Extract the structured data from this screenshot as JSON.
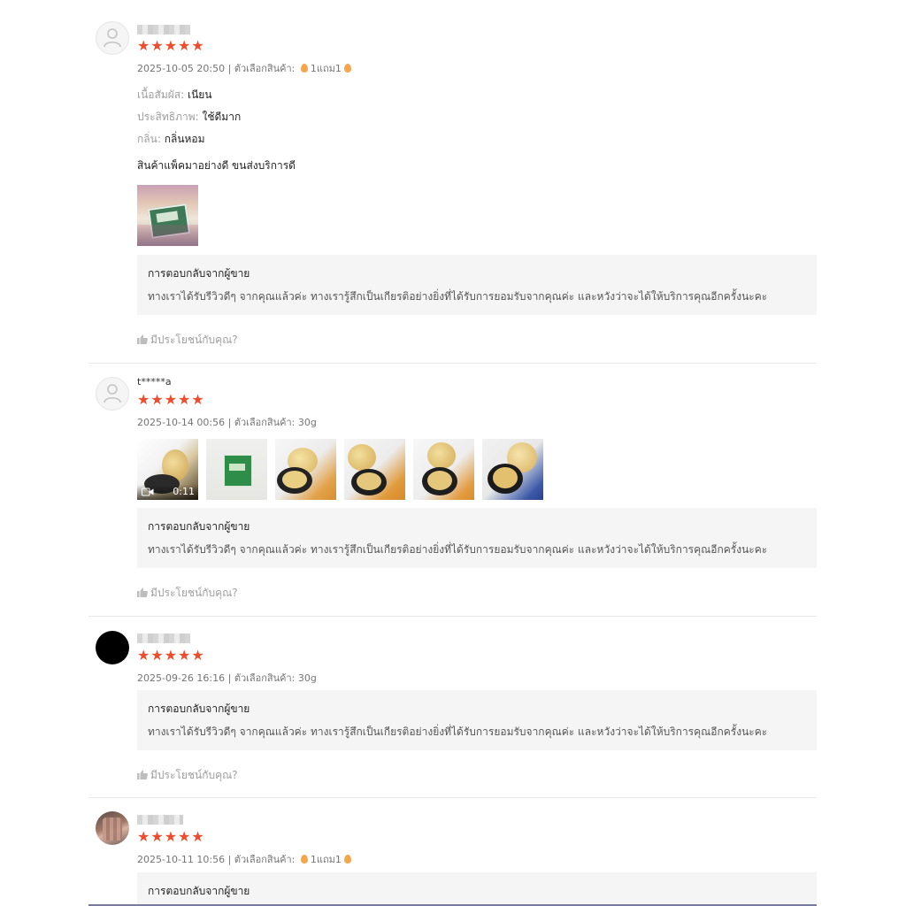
{
  "reviews": [
    {
      "username": "",
      "rating": 5,
      "date": "2025-10-05 20:50",
      "variation_label": "ตัวเลือกสินค้า:",
      "variation": "1แถม1",
      "attributes": [
        {
          "key": "เนื้อสัมผัส:",
          "value": "เนียน"
        },
        {
          "key": "ประสิทธิภาพ:",
          "value": "ใช้ดีมาก"
        },
        {
          "key": "กลิ่น:",
          "value": "กลิ่นหอม"
        }
      ],
      "comment": "สินค้าแพ็คมาอย่างดี ขนส่งบริการดี",
      "seller_reply_title": "การตอบกลับจากผู้ขาย",
      "seller_reply": "ทางเราได้รับรีวิวดีๆ จากคุณแล้วค่ะ ทางเรารู้สึกเป็นเกียรติอย่างยิ่งที่ได้รับการยอมรับจากคุณค่ะ และหวังว่าจะได้ให้บริการคุณอีกครั้งนะคะ",
      "helpful": "มีประโยชน์กับคุณ?"
    },
    {
      "username": "t*****a",
      "rating": 5,
      "date": "2025-10-14 00:56",
      "variation_label": "ตัวเลือกสินค้า:",
      "variation": "30g",
      "video_duration": "0:11",
      "seller_reply_title": "การตอบกลับจากผู้ขาย",
      "seller_reply": "ทางเราได้รับรีวิวดีๆ จากคุณแล้วค่ะ ทางเรารู้สึกเป็นเกียรติอย่างยิ่งที่ได้รับการยอมรับจากคุณค่ะ และหวังว่าจะได้ให้บริการคุณอีกครั้งนะคะ",
      "helpful": "มีประโยชน์กับคุณ?"
    },
    {
      "username": "",
      "rating": 5,
      "date": "2025-09-26 16:16",
      "variation_label": "ตัวเลือกสินค้า:",
      "variation": "30g",
      "seller_reply_title": "การตอบกลับจากผู้ขาย",
      "seller_reply": "ทางเราได้รับรีวิวดีๆ จากคุณแล้วค่ะ ทางเรารู้สึกเป็นเกียรติอย่างยิ่งที่ได้รับการยอมรับจากคุณค่ะ และหวังว่าจะได้ให้บริการคุณอีกครั้งนะคะ",
      "helpful": "มีประโยชน์กับคุณ?"
    },
    {
      "username": "",
      "rating": 5,
      "date": "2025-10-11 10:56",
      "variation_label": "ตัวเลือกสินค้า:",
      "variation": "1แถม1",
      "seller_reply_title": "การตอบกลับจากผู้ขาย"
    }
  ],
  "colors": {
    "star": "#ee4d2d",
    "reply_bg": "#f5f5f5",
    "meta_text": "#757575"
  }
}
